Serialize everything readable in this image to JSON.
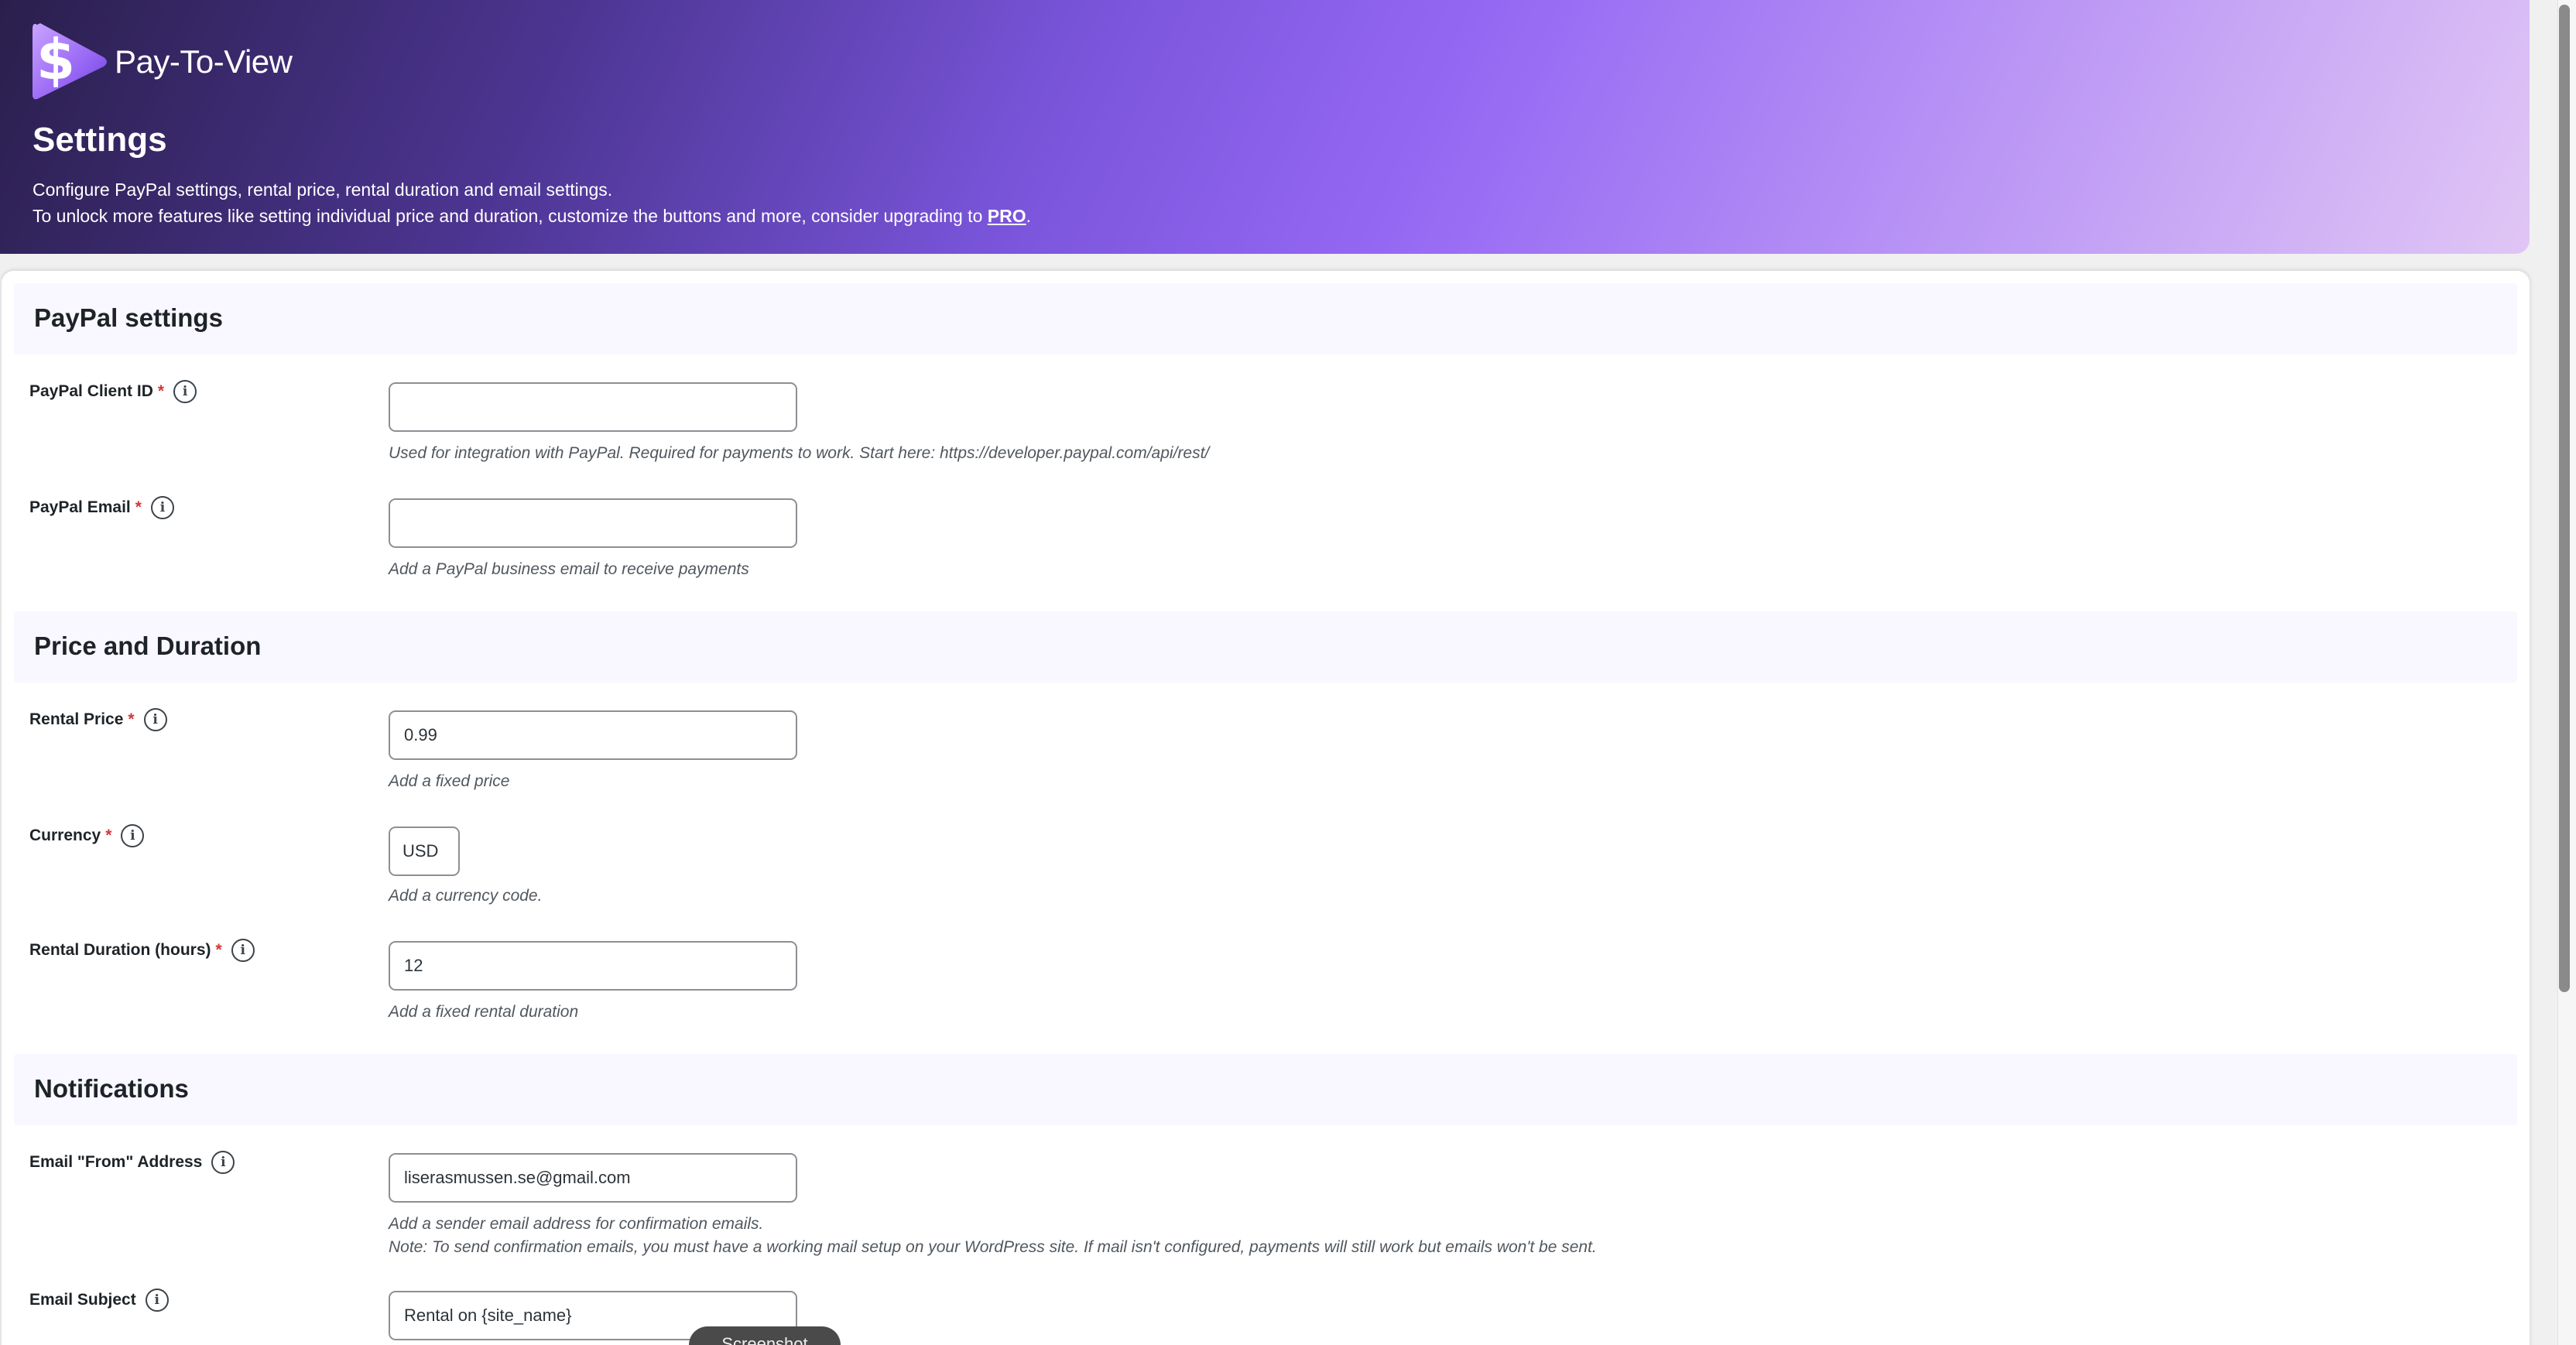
{
  "header": {
    "brand_name": "Pay-To-View",
    "title": "Settings",
    "intro_line1": "Configure PayPal settings, rental price, rental duration and email settings.",
    "intro_line2_prefix": "To unlock more features like setting individual price and duration, customize the buttons and more, consider upgrading to ",
    "pro_link": "PRO",
    "intro_line2_suffix": "."
  },
  "sections": {
    "paypal": {
      "title": "PayPal settings",
      "client_id": {
        "label": "PayPal Client ID",
        "value": "",
        "hint": "Used for integration with PayPal. Required for payments to work. Start here: https://developer.paypal.com/api/rest/"
      },
      "email": {
        "label": "PayPal Email",
        "value": "",
        "hint": "Add a PayPal business email to receive payments"
      }
    },
    "price": {
      "title": "Price and Duration",
      "rental_price": {
        "label": "Rental Price",
        "value": "0.99",
        "hint": "Add a fixed price"
      },
      "currency": {
        "label": "Currency",
        "value": "USD",
        "hint": "Add a currency code."
      },
      "duration": {
        "label": "Rental Duration (hours)",
        "value": "12",
        "hint": "Add a fixed rental duration"
      }
    },
    "notifications": {
      "title": "Notifications",
      "from_address": {
        "label": "Email \"From\" Address",
        "value": "liserasmussen.se@gmail.com",
        "hint1": "Add a sender email address for confirmation emails.",
        "hint2": "Note: To send confirmation emails, you must have a working mail setup on your WordPress site. If mail isn't configured, payments will still work but emails won't be sent."
      },
      "subject": {
        "label": "Email Subject",
        "value": "Rental on {site_name}"
      }
    }
  },
  "required_marker": "*",
  "info_glyph": "i",
  "overlay": {
    "screenshot_label": "Screenshot"
  },
  "colors": {
    "accent": "#9467f3",
    "required": "#d63638",
    "section_bg": "#f9f7ff"
  }
}
